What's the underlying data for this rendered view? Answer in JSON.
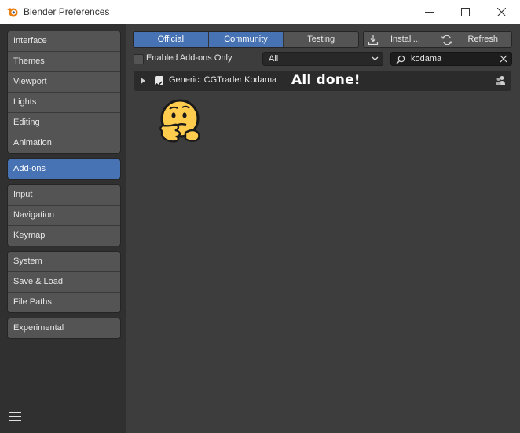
{
  "window": {
    "title": "Blender Preferences",
    "controls": [
      "minimize-icon",
      "maximize-icon",
      "close-icon"
    ]
  },
  "sidebar": {
    "groups": [
      {
        "items": [
          {
            "label": "Interface",
            "active": false
          },
          {
            "label": "Themes",
            "active": false
          },
          {
            "label": "Viewport",
            "active": false
          },
          {
            "label": "Lights",
            "active": false
          },
          {
            "label": "Editing",
            "active": false
          },
          {
            "label": "Animation",
            "active": false
          }
        ]
      },
      {
        "items": [
          {
            "label": "Add-ons",
            "active": true
          }
        ]
      },
      {
        "items": [
          {
            "label": "Input",
            "active": false
          },
          {
            "label": "Navigation",
            "active": false
          },
          {
            "label": "Keymap",
            "active": false
          }
        ]
      },
      {
        "items": [
          {
            "label": "System",
            "active": false
          },
          {
            "label": "Save & Load",
            "active": false
          },
          {
            "label": "File Paths",
            "active": false
          }
        ]
      },
      {
        "items": [
          {
            "label": "Experimental",
            "active": false
          }
        ]
      }
    ],
    "menu_icon": "hamburger-icon"
  },
  "toolbar": {
    "tabs": [
      {
        "label": "Official",
        "active": true
      },
      {
        "label": "Community",
        "active": true
      },
      {
        "label": "Testing",
        "active": false
      }
    ],
    "install_label": "Install...",
    "refresh_label": "Refresh"
  },
  "filters": {
    "enabled_only_label": "Enabled Add-ons Only",
    "enabled_only_checked": false,
    "category_value": "All",
    "search_value": "kodama"
  },
  "addons": [
    {
      "name": "Generic: CGTrader Kodama",
      "enabled": true,
      "expanded": false
    }
  ],
  "overlay": {
    "message": "All done!",
    "emoji": "thinking-face-icon"
  },
  "colors": {
    "accent": "#4772b3",
    "panel": "#3d3d3d",
    "sidebar": "#303030",
    "button": "#545454"
  }
}
